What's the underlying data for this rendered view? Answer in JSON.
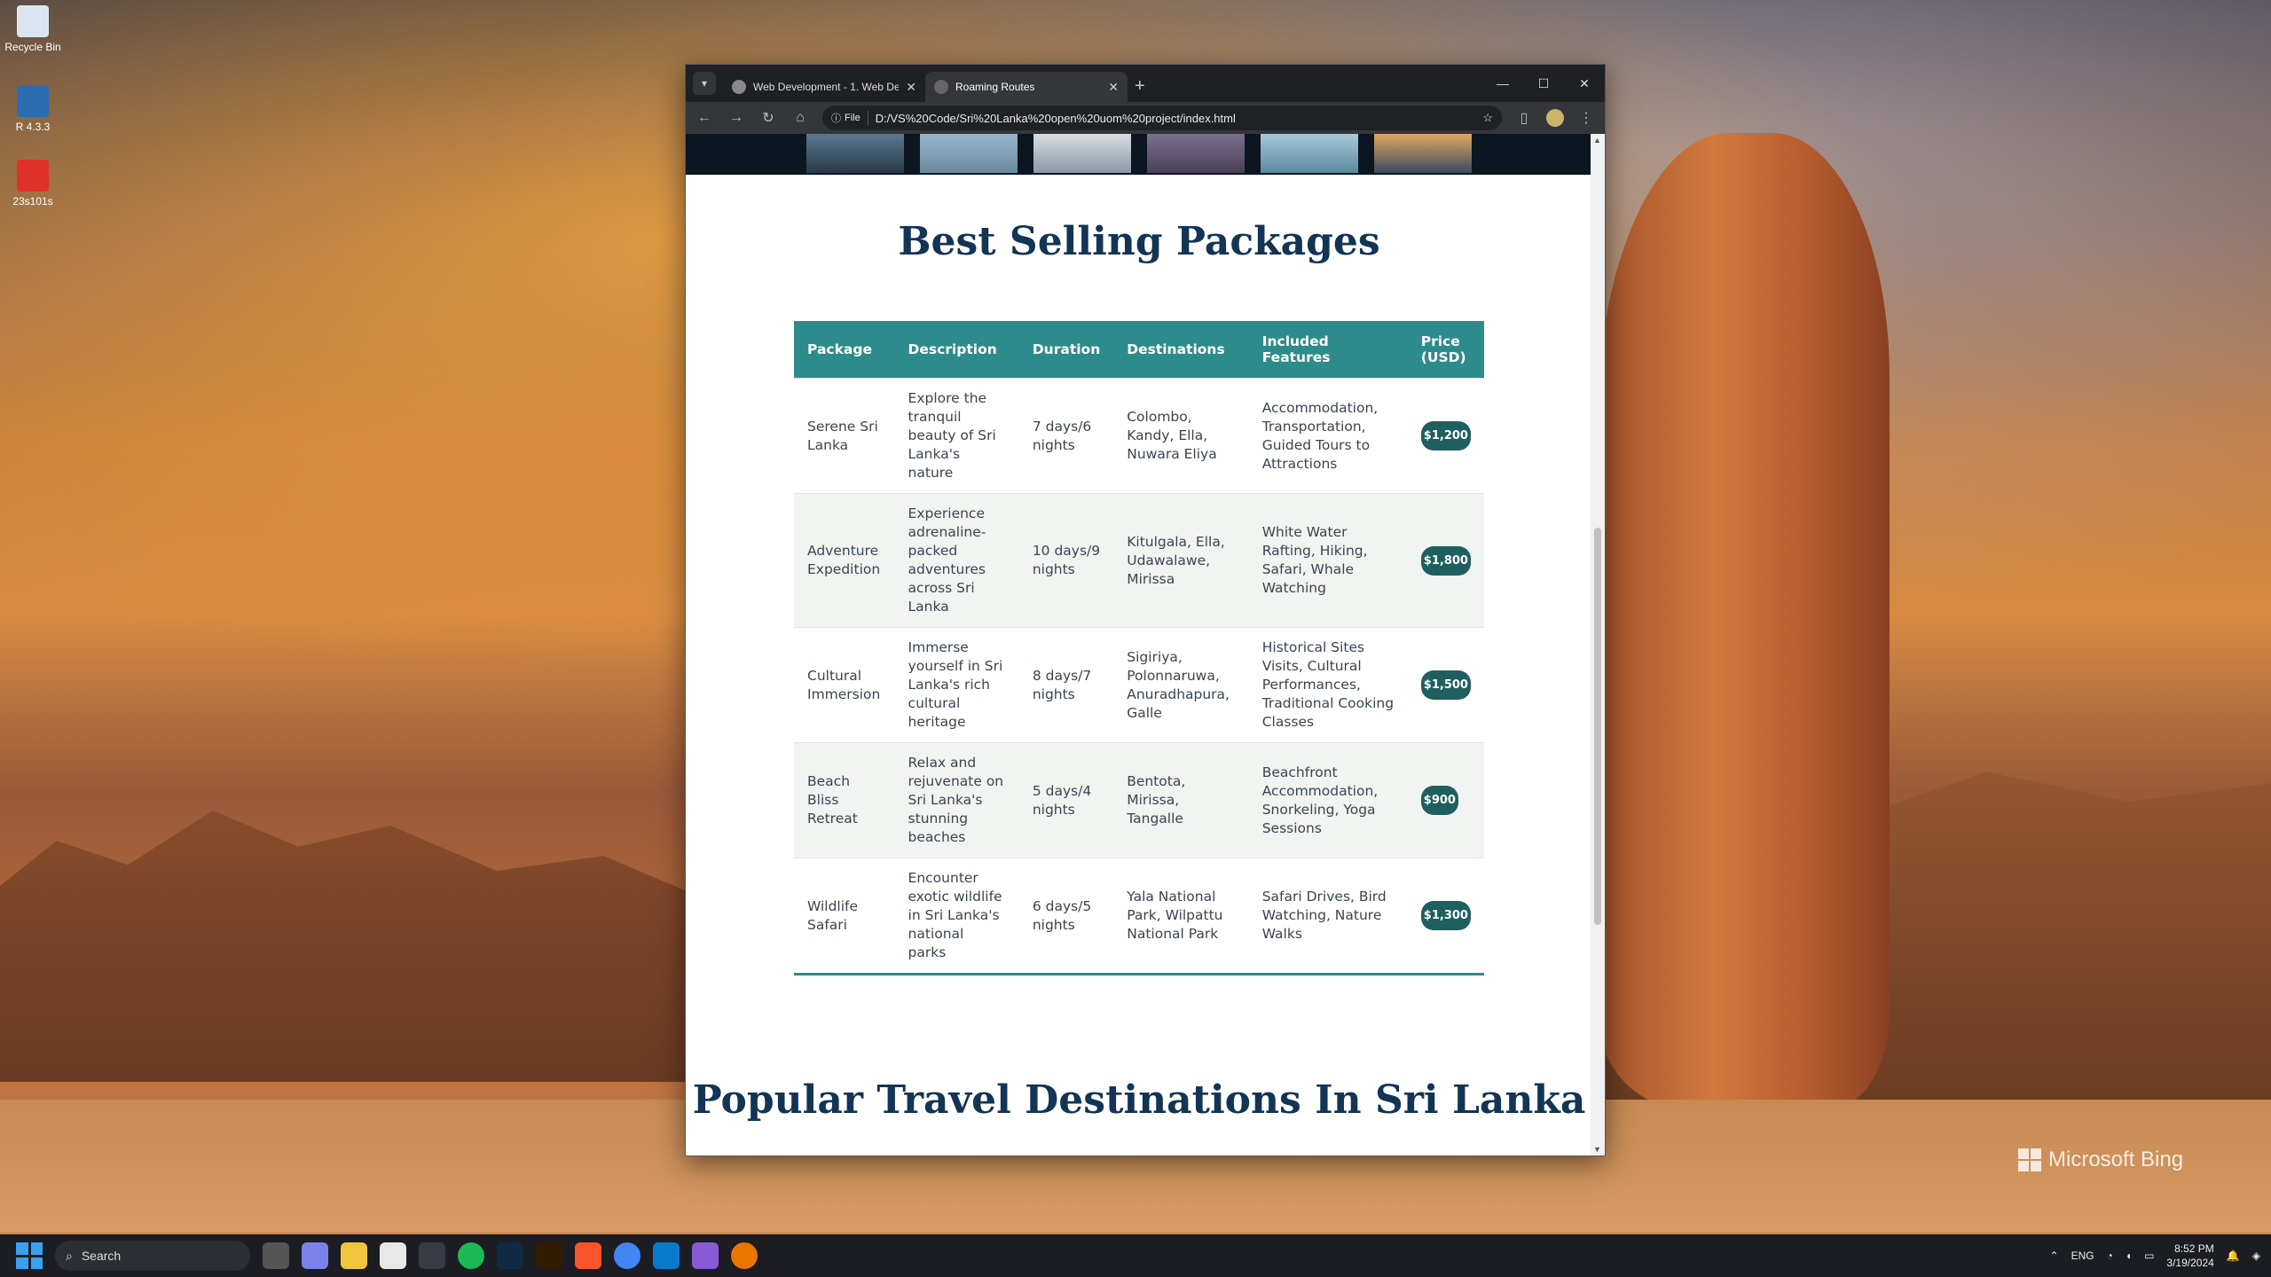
{
  "desktop": {
    "icons": [
      {
        "label": "Recycle Bin"
      },
      {
        "label": "R 4.3.3"
      },
      {
        "label": "23s101s"
      }
    ],
    "bing": "Microsoft Bing"
  },
  "browser": {
    "tabs": [
      {
        "title": "Web Development - 1. Web De"
      },
      {
        "title": "Roaming Routes"
      }
    ],
    "address_chip": "File",
    "url": "D:/VS%20Code/Sri%20Lanka%20open%20uom%20project/index.html"
  },
  "page": {
    "heading": "Best Selling Packages",
    "table": {
      "headers": [
        "Package",
        "Description",
        "Duration",
        "Destinations",
        "Included Features",
        "Price (USD)"
      ],
      "rows": [
        {
          "package": "Serene Sri Lanka",
          "description": "Explore the tranquil beauty of Sri Lanka's nature",
          "duration": "7 days/6 nights",
          "destinations": "Colombo, Kandy, Ella, Nuwara Eliya",
          "features": "Accommodation, Transportation, Guided Tours to Attractions",
          "price": "$1,200"
        },
        {
          "package": "Adventure Expedition",
          "description": "Experience adrenaline-packed adventures across Sri Lanka",
          "duration": "10 days/9 nights",
          "destinations": "Kitulgala, Ella, Udawalawe, Mirissa",
          "features": "White Water Rafting, Hiking, Safari, Whale Watching",
          "price": "$1,800"
        },
        {
          "package": "Cultural Immersion",
          "description": "Immerse yourself in Sri Lanka's rich cultural heritage",
          "duration": "8 days/7 nights",
          "destinations": "Sigiriya, Polonnaruwa, Anuradhapura, Galle",
          "features": "Historical Sites Visits, Cultural Performances, Traditional Cooking Classes",
          "price": "$1,500"
        },
        {
          "package": "Beach Bliss Retreat",
          "description": "Relax and rejuvenate on Sri Lanka's stunning beaches",
          "duration": "5 days/4 nights",
          "destinations": "Bentota, Mirissa, Tangalle",
          "features": "Beachfront Accommodation, Snorkeling, Yoga Sessions",
          "price": "$900"
        },
        {
          "package": "Wildlife Safari",
          "description": "Encounter exotic wildlife in Sri Lanka's national parks",
          "duration": "6 days/5 nights",
          "destinations": "Yala National Park, Wilpattu National Park",
          "features": "Safari Drives, Bird Watching, Nature Walks",
          "price": "$1,300"
        }
      ]
    },
    "section2_heading": "Popular Travel Destinations In Sri Lanka"
  },
  "taskbar": {
    "search_placeholder": "Search",
    "language": "ENG",
    "time": "8:52 PM",
    "date": "3/19/2024",
    "apps": [
      "file-explorer-icon",
      "teams-icon",
      "folder-icon",
      "store-icon",
      "obs-icon",
      "spotify-icon",
      "photoshop-icon",
      "illustrator-icon",
      "brave-icon",
      "chrome-icon",
      "vscode-icon",
      "visual-studio-icon",
      "blender-icon"
    ]
  },
  "colors": {
    "accent_teal": "#2e8b8b",
    "price_badge": "#1f5f5f",
    "heading_navy": "#123455"
  }
}
